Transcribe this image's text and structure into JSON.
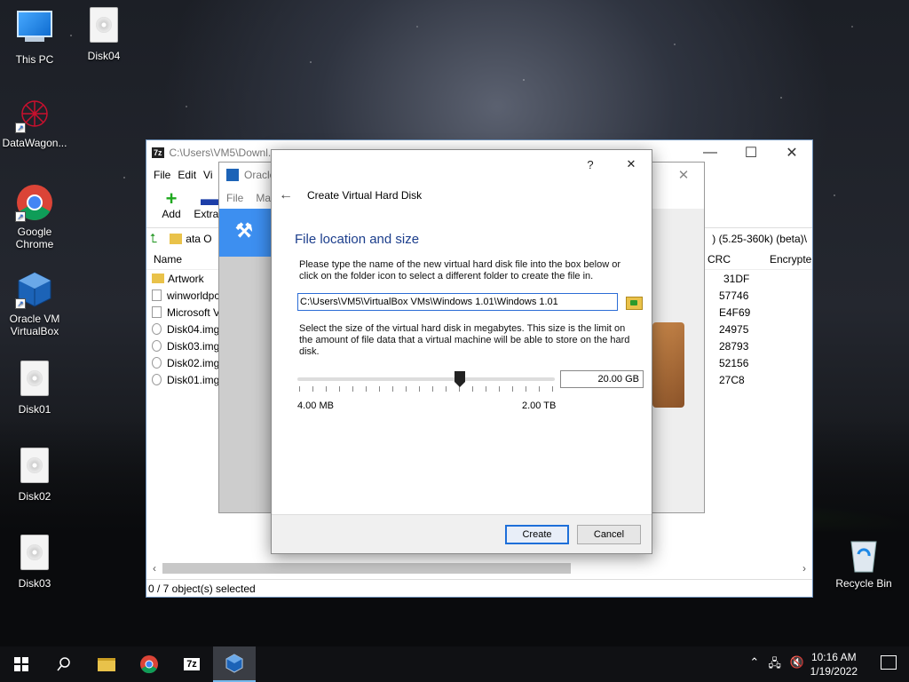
{
  "desktop": {
    "icons": [
      {
        "label": "This PC"
      },
      {
        "label": "Disk04"
      },
      {
        "label": "DataWagon..."
      },
      {
        "label": "Google Chrome"
      },
      {
        "label": "Oracle VM VirtualBox"
      },
      {
        "label": "Disk01"
      },
      {
        "label": "Disk02"
      },
      {
        "label": "Disk03"
      },
      {
        "label": "Recycle Bin"
      }
    ]
  },
  "zip": {
    "title": "C:\\Users\\VM5\\Downl...",
    "menu": [
      "File",
      "Edit",
      "Vi"
    ],
    "tools": [
      {
        "label": "Add"
      },
      {
        "label": "Extract"
      }
    ],
    "address": "ata O",
    "address_right": ") (5.25-360k) (beta)\\",
    "columns": {
      "name": "Name",
      "crc": "CRC",
      "encrypted": "Encrypte"
    },
    "rows": [
      {
        "name": "Artwork",
        "crc": "31DF"
      },
      {
        "name": "winworldpc",
        "crc": "57746"
      },
      {
        "name": "Microsoft V",
        "crc": "E4F69"
      },
      {
        "name": "Disk04.img",
        "crc": "24975"
      },
      {
        "name": "Disk03.img",
        "crc": "28793"
      },
      {
        "name": "Disk02.img",
        "crc": "52156"
      },
      {
        "name": "Disk01.img",
        "crc": "27C8"
      }
    ],
    "status": "0 / 7 object(s) selected"
  },
  "vbox": {
    "title": "Oracle",
    "menu": [
      "File",
      "Ma"
    ]
  },
  "dialog": {
    "help_glyph": "?",
    "close_glyph": "✕",
    "title": "Create Virtual Hard Disk",
    "section": "File location and size",
    "para1": "Please type the name of the new virtual hard disk file into the box below or click on the folder icon to select a different folder to create the file in.",
    "path_value": "C:\\Users\\VM5\\VirtualBox VMs\\Windows 1.01\\Windows 1.01",
    "para2": "Select the size of the virtual hard disk in megabytes. This size is the limit on the amount of file data that a virtual machine will be able to store on the hard disk.",
    "size_value": "20.00 GB",
    "slider_position": 0.63,
    "min_label": "4.00 MB",
    "max_label": "2.00 TB",
    "create_label": "Create",
    "cancel_label": "Cancel"
  },
  "taskbar": {
    "time": "10:16 AM",
    "date": "1/19/2022",
    "icons": [
      "windows-start",
      "search",
      "file-explorer",
      "chrome",
      "7zip",
      "virtualbox"
    ]
  }
}
